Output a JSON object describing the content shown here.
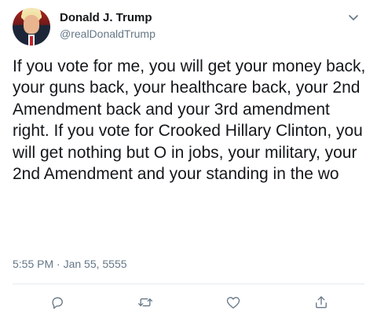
{
  "tweet": {
    "author_name": "Donald J. Trump",
    "author_handle": "@realDonaldTrump",
    "text": "If you vote for me, you will get your money back, your guns back, your healthcare back, your 2nd Amendment back and your 3rd amendment right. If you vote for Crooked Hillary Clinton, you will get nothing but O in jobs, your military, your 2nd Amendment and your standing in the wo",
    "timestamp": "5:55 PM · Jan 55, 5555"
  },
  "icons": {
    "menu": "chevron-down-icon",
    "reply": "reply-icon",
    "retweet": "retweet-icon",
    "like": "heart-icon",
    "share": "share-icon"
  },
  "colors": {
    "text": "#14171a",
    "secondary": "#657786",
    "divider": "#e6ecf0"
  }
}
